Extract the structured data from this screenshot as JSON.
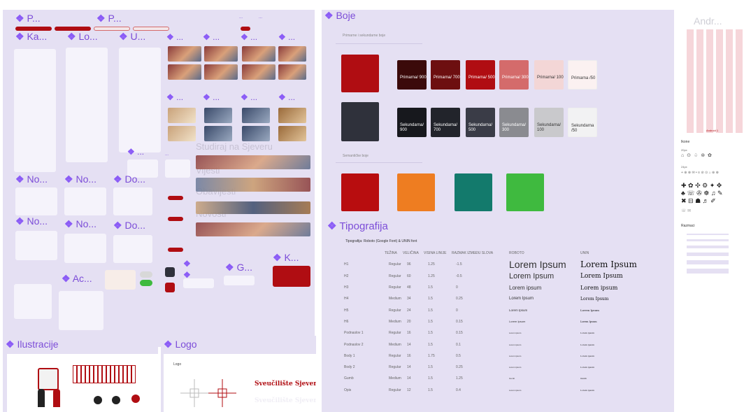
{
  "left_panel": {
    "section_titles": {
      "p1": "P...",
      "p2": "P...",
      "ka": "Ka...",
      "lo": "Lo...",
      "u": "U...",
      "d1": "...",
      "d2": "...",
      "d3": "...",
      "d4": "...",
      "no1": "No...",
      "no2": "No...",
      "do1": "Do...",
      "no3": "No...",
      "no4": "No...",
      "do2": "Do...",
      "ac": "Ac...",
      "g": "G...",
      "k": "K..."
    },
    "watermark": {
      "line1": "Studiraj na Sjeveru",
      "line2": "Vijesti",
      "line3": "Obavijesti",
      "line4": "Novosti"
    },
    "ellipsis": "..."
  },
  "boje": {
    "title": "Boje",
    "primary_label": "Primarne i sekundarne boje",
    "semantic_label": "Semantičke boje",
    "primary_swatches": [
      {
        "label": "Primarna/ 900",
        "color": "#3b0a0a",
        "text": "#ffffff"
      },
      {
        "label": "Primarna/ 700",
        "color": "#6d0f10",
        "text": "#ffffff"
      },
      {
        "label": "Primarna/ 500",
        "color": "#b00d12",
        "text": "#ffffff"
      },
      {
        "label": "Primarna/ 300",
        "color": "#d46b6b",
        "text": "#ffffff"
      },
      {
        "label": "Primarna/ 100",
        "color": "#f3d6d6",
        "text": "#333333"
      },
      {
        "label": "Primarna /50",
        "color": "#fbf1f1",
        "text": "#333333"
      }
    ],
    "secondary_swatches": [
      {
        "label": "Sekundarna/ 900",
        "color": "#17181d",
        "text": "#ffffff"
      },
      {
        "label": "Sekundarna/ 700",
        "color": "#22242b",
        "text": "#ffffff"
      },
      {
        "label": "Sekundarna/ 500",
        "color": "#3a3c47",
        "text": "#ffffff"
      },
      {
        "label": "Sekundarna/ 300",
        "color": "#8a8b90",
        "text": "#ffffff"
      },
      {
        "label": "Sekundarna/ 100",
        "color": "#c9c9cc",
        "text": "#333333"
      },
      {
        "label": "Sekundarna /50",
        "color": "#f2f2f3",
        "text": "#333333"
      }
    ],
    "primary_big": "#b00d12",
    "secondary_big": "#2f313b",
    "semantic": [
      "#b80d0f",
      "#ee7d21",
      "#137a6c",
      "#3fba3f"
    ]
  },
  "tipografija": {
    "title": "Tipografija",
    "subtitle": "Tipografija: Roboto (Google Font) & UNIN font",
    "headers": [
      "",
      "TEŽINA",
      "VELIČINA",
      "VISINA LINIJE",
      "RAZMAK IZMEĐU SLOVA",
      "ROBOTO",
      "UNIN"
    ],
    "rows": [
      {
        "name": "H1",
        "weight": "Regular",
        "size": "96",
        "lh": "1.25",
        "ls": "-1.5",
        "sample": "Lorem Ipsum"
      },
      {
        "name": "H2",
        "weight": "Regular",
        "size": "60",
        "lh": "1.25",
        "ls": "-0.5",
        "sample": "Lorem Ipsum"
      },
      {
        "name": "H3",
        "weight": "Regular",
        "size": "48",
        "lh": "1.5",
        "ls": "0",
        "sample": "Lorem ipsum"
      },
      {
        "name": "H4",
        "weight": "Medium",
        "size": "34",
        "lh": "1.5",
        "ls": "0.25",
        "sample": "Lorem Ipsum"
      },
      {
        "name": "H5",
        "weight": "Regular",
        "size": "24",
        "lh": "1.5",
        "ls": "0",
        "sample": "Lorem Ipsum"
      },
      {
        "name": "H6",
        "weight": "Medium",
        "size": "20",
        "lh": "1.5",
        "ls": "0.15",
        "sample": "Lorem Ipsum"
      },
      {
        "name": "Podnaslov 1",
        "weight": "Regular",
        "size": "16",
        "lh": "1.5",
        "ls": "0.15",
        "sample": "Lorem ipsum"
      },
      {
        "name": "Podnaslov 2",
        "weight": "Medium",
        "size": "14",
        "lh": "1.5",
        "ls": "0.1",
        "sample": "Lorem ipsum"
      },
      {
        "name": "Body 1",
        "weight": "Regular",
        "size": "16",
        "lh": "1.75",
        "ls": "0.5",
        "sample": "Lorem ipsum"
      },
      {
        "name": "Body 2",
        "weight": "Regular",
        "size": "14",
        "lh": "1.5",
        "ls": "0.25",
        "sample": "Lorem ipsum"
      },
      {
        "name": "Gumb",
        "weight": "Medium",
        "size": "14",
        "lh": "1.5",
        "ls": "1.25",
        "sample": "Gumb"
      },
      {
        "name": "Opis",
        "weight": "Regular",
        "size": "12",
        "lh": "1.5",
        "ls": "0.4",
        "sample": "Lorem ipsum"
      }
    ]
  },
  "ilustracije": {
    "title": "Ilustracije"
  },
  "logo": {
    "title": "Logo",
    "label": "Logo",
    "name_red": "Sveučilište Sjever",
    "name_white": "Sveučilište Sjever"
  },
  "android": {
    "title": "Andr...",
    "grid_caption": "Android 1",
    "ikone": "Ikone",
    "size": "20px",
    "size2": "24px",
    "razmaci": "Razmaci"
  }
}
